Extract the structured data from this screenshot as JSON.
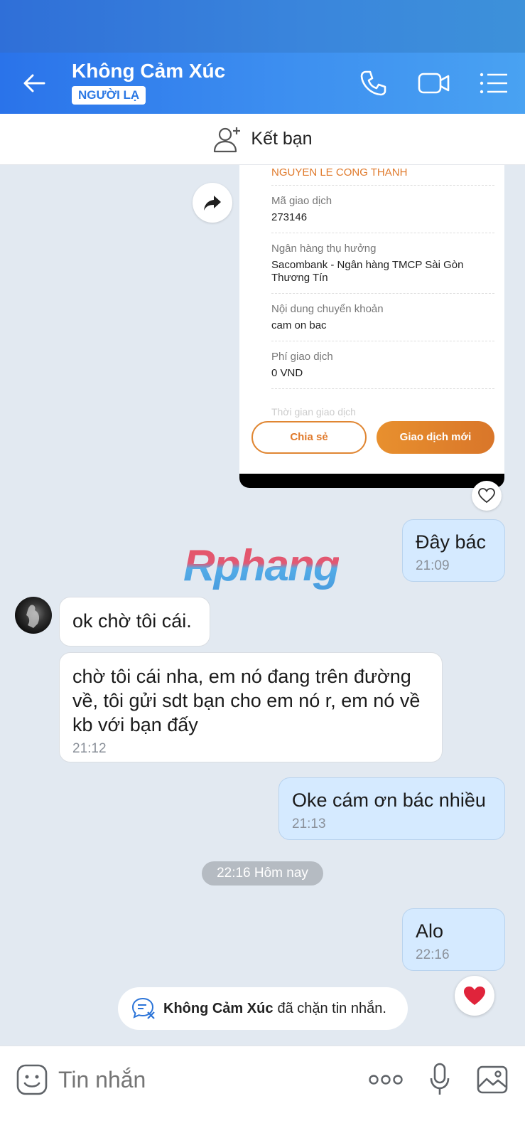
{
  "header": {
    "title": "Không Cảm Xúc",
    "badge": "NGƯỜI LẠ",
    "icons": [
      "back-arrow-icon",
      "phone-icon",
      "video-call-icon",
      "menu-list-icon"
    ]
  },
  "add_friend": {
    "label": "Kết bạn",
    "icon": "add-friend-icon"
  },
  "receipt": {
    "recipient_name": "NGUYEN LE CONG THANH",
    "fields": [
      {
        "label": "Mã giao dịch",
        "value": "273146"
      },
      {
        "label": "Ngân hàng thụ hưởng",
        "value": "Sacombank - Ngân hàng TMCP Sài Gòn Thương Tín"
      },
      {
        "label": "Nội dung chuyển khoản",
        "value": "cam on bac"
      },
      {
        "label": "Phí giao dịch",
        "value": "0 VND"
      }
    ],
    "faded_label": "Thời gian giao dịch",
    "share_button": "Chia sẻ",
    "new_transaction_button": "Giao dịch mới"
  },
  "messages": [
    {
      "sender": "me",
      "text": "Đây bác",
      "time": "21:09"
    },
    {
      "sender": "them",
      "text": "ok chờ tôi cái.",
      "time": ""
    },
    {
      "sender": "them",
      "text": "chờ tôi cái nha, em nó đang trên đường về, tôi gửi sdt bạn cho em nó r, em nó về kb với bạn đấy",
      "time": "21:12"
    },
    {
      "sender": "me",
      "text": "Oke cám ơn bác nhiều",
      "time": "21:13"
    },
    {
      "sender": "me",
      "text": "Alo",
      "time": "22:16"
    }
  ],
  "watermark": "Rphang",
  "date_divider": "22:16 Hôm nay",
  "blocked_notice": {
    "name": "Không Cảm Xúc",
    "text": "đã chặn tin nhắn."
  },
  "input_bar": {
    "placeholder": "Tin nhắn"
  },
  "colors": {
    "header_blue": "#2a73ea",
    "my_bubble": "#d5eaff",
    "accent_orange": "#e07a2c",
    "heart_red": "#e0243b"
  }
}
